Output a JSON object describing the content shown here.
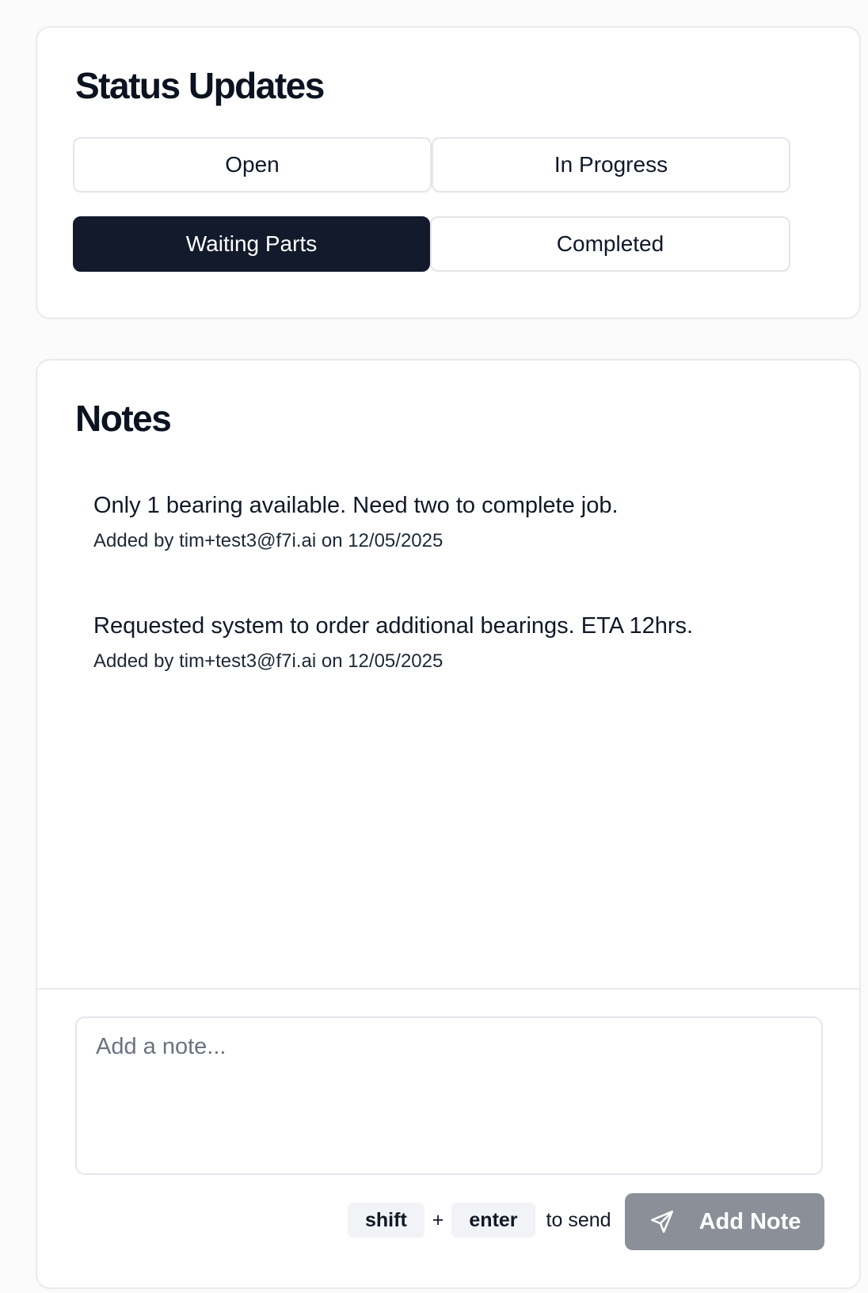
{
  "status_updates": {
    "title": "Status Updates",
    "options": [
      {
        "label": "Open",
        "active": false
      },
      {
        "label": "In Progress",
        "active": false
      },
      {
        "label": "Waiting Parts",
        "active": true
      },
      {
        "label": "Completed",
        "active": false
      }
    ]
  },
  "notes": {
    "title": "Notes",
    "items": [
      {
        "text": "Only 1 bearing available. Need two to complete job.",
        "meta": "Added by tim+test3@f7i.ai on 12/05/2025"
      },
      {
        "text": "Requested system to order additional bearings. ETA 12hrs.",
        "meta": "Added by tim+test3@f7i.ai on 12/05/2025"
      }
    ],
    "input": {
      "placeholder": "Add a note...",
      "value": ""
    },
    "hint": {
      "key1": "shift",
      "plus": "+",
      "key2": "enter",
      "suffix": "to send"
    },
    "add_button": {
      "label": "Add Note",
      "icon": "send-icon"
    }
  },
  "colors": {
    "active_status_bg": "#131a2b",
    "add_button_bg": "#8b8f97",
    "border": "#e3e6eb"
  }
}
